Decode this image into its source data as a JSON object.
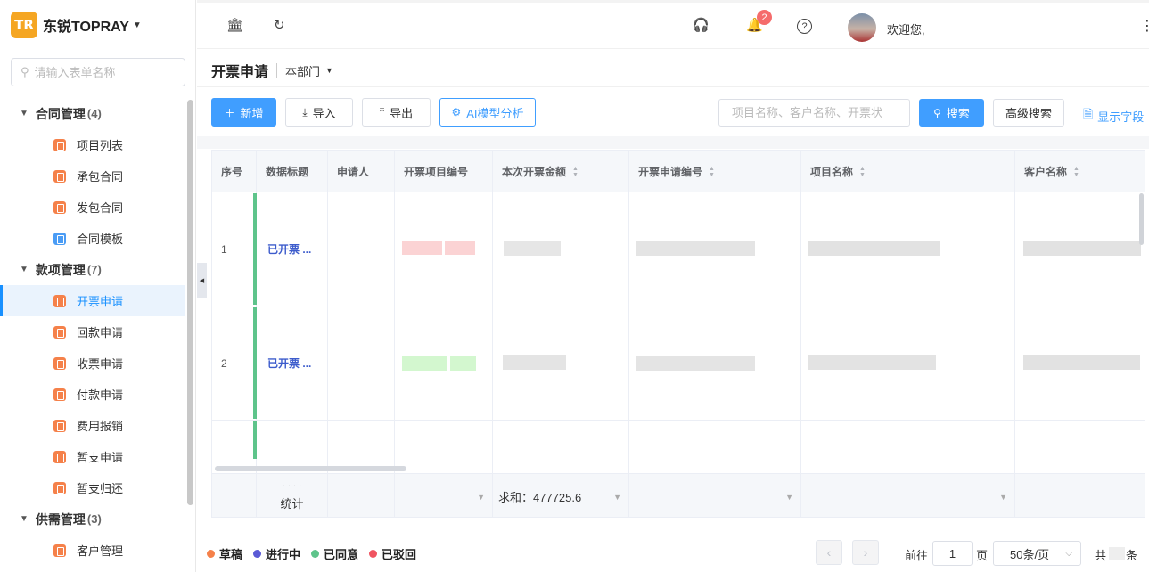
{
  "brand": {
    "name": "东锐TOPRAY",
    "logo_letters": "TR"
  },
  "sidebar": {
    "search_placeholder": "请输入表单名称",
    "groups": [
      {
        "label": "合同管理",
        "count": "(4)",
        "items": [
          "项目列表",
          "承包合同",
          "发包合同",
          "合同模板"
        ]
      },
      {
        "label": "款项管理",
        "count": "(7)",
        "items": [
          "开票申请",
          "回款申请",
          "收票申请",
          "付款申请",
          "费用报销",
          "暂支申请",
          "暂支归还"
        ]
      },
      {
        "label": "供需管理",
        "count": "(3)",
        "items": [
          "客户管理"
        ]
      }
    ],
    "active_item": "开票申请"
  },
  "topbar": {
    "notification_count": "2",
    "welcome": "欢迎您,"
  },
  "page": {
    "title": "开票申请",
    "scope": "本部门"
  },
  "toolbar": {
    "add": "新增",
    "import": "导入",
    "export": "导出",
    "ai": "AI模型分析",
    "search_placeholder": "项目名称、客户名称、开票状",
    "search": "搜索",
    "advanced": "高级搜索",
    "show_fields": "显示字段"
  },
  "table": {
    "columns": [
      "序号",
      "数据标题",
      "申请人",
      "开票项目编号",
      "本次开票金额",
      "开票申请编号",
      "项目名称",
      "客户名称"
    ],
    "rows": [
      {
        "index": "1",
        "title": "已开票 ..."
      },
      {
        "index": "2",
        "title": "已开票 ..."
      }
    ],
    "footer": {
      "dots": "· · · ·",
      "label": "统计",
      "sum": "求和：477725.6"
    }
  },
  "legend": [
    {
      "label": "草稿",
      "color": "#f5814a"
    },
    {
      "label": "进行中",
      "color": "#5b5bd6"
    },
    {
      "label": "已同意",
      "color": "#5ec48b"
    },
    {
      "label": "已驳回",
      "color": "#f05461"
    }
  ],
  "pager": {
    "goto": "前往",
    "page_value": "1",
    "page_unit": "页",
    "page_size": "50条/页",
    "total_prefix": "共",
    "total_suffix": "条"
  }
}
